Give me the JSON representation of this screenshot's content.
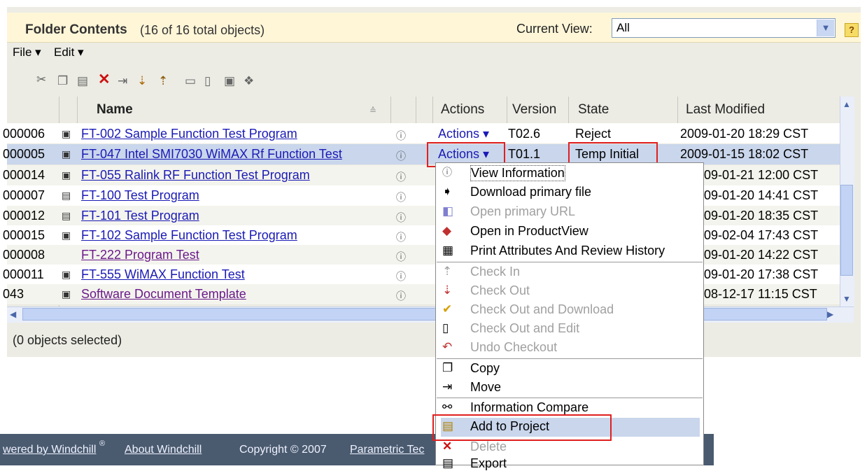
{
  "header": {
    "title": "Folder Contents",
    "count": "(16 of 16 total objects)",
    "view_label": "Current View:",
    "view_value": "All",
    "help": "?"
  },
  "menubar": {
    "file": "File ▾",
    "edit": "Edit ▾"
  },
  "toolbar": {
    "icons": [
      "cut-icon",
      "copy-icon",
      "paste-icon",
      "delete-icon",
      "move-icon",
      "checkout-icon",
      "checkin-icon",
      "new-folder-icon",
      "new-document-icon",
      "new-part-icon",
      "new-link-icon"
    ]
  },
  "columns": {
    "name": "Name",
    "actions": "Actions",
    "version": "Version",
    "state": "State",
    "last_modified": "Last Modified"
  },
  "rows": [
    {
      "number": "000006",
      "name": "FT-002 Sample Function Test Program",
      "actions": "Actions ▾",
      "version": "T02.6",
      "state": "Reject",
      "modified": "2009-01-20 18:29 CST"
    },
    {
      "number": "000005",
      "name": "FT-047 Intel SMI7030 WiMAX Rf Function Test",
      "actions": "Actions ▾",
      "version": "T01.1",
      "state": "Temp Initial",
      "modified": "2009-01-15 18:02 CST"
    },
    {
      "number": "000014",
      "name": "FT-055 Ralink RF Function Test Program",
      "modified": "09-01-21 12:00 CST"
    },
    {
      "number": "000007",
      "name": "FT-100 Test Program",
      "modified": "09-01-20 14:41 CST"
    },
    {
      "number": "000012",
      "name": "FT-101 Test Program",
      "modified": "09-01-20 18:35 CST"
    },
    {
      "number": "000015",
      "name": "FT-102 Sample Function Test Program",
      "modified": "09-02-04 17:43 CST"
    },
    {
      "number": "000008",
      "name": "FT-222 Program Test",
      "modified": "09-01-20 14:22 CST"
    },
    {
      "number": "000011",
      "name": "FT-555 WiMAX Function Test",
      "modified": "09-01-20 17:38 CST"
    },
    {
      "number": "043",
      "name": "Software Document Template",
      "modified": "08-12-17 11:15 CST"
    }
  ],
  "status": "(0 objects selected)",
  "context_menu": [
    {
      "label": "View Information",
      "icon": "info-icon",
      "enabled": true
    },
    {
      "label": "Download primary file",
      "icon": "download-icon",
      "enabled": true
    },
    {
      "label": "Open primary URL",
      "icon": "url-icon",
      "enabled": false
    },
    {
      "label": "Open in ProductView",
      "icon": "productview-icon",
      "enabled": true
    },
    {
      "label": "Print Attributes And Review History",
      "icon": "print-icon",
      "enabled": true
    },
    {
      "label": "Check In",
      "icon": "checkin-icon",
      "enabled": false
    },
    {
      "label": "Check Out",
      "icon": "checkout-icon",
      "enabled": false
    },
    {
      "label": "Check Out and Download",
      "icon": "checkout-download-icon",
      "enabled": false
    },
    {
      "label": "Check Out and Edit",
      "icon": "checkout-edit-icon",
      "enabled": false
    },
    {
      "label": "Undo Checkout",
      "icon": "undo-checkout-icon",
      "enabled": false
    },
    {
      "label": "Copy",
      "icon": "copy-icon",
      "enabled": true
    },
    {
      "label": "Move",
      "icon": "move-icon",
      "enabled": true
    },
    {
      "label": "Information Compare",
      "icon": "compare-icon",
      "enabled": true
    },
    {
      "label": "Add to Project",
      "icon": "add-project-icon",
      "enabled": true
    },
    {
      "label": "Delete",
      "icon": "delete-icon",
      "enabled": false
    },
    {
      "label": "Export",
      "icon": "export-icon",
      "enabled": true
    }
  ],
  "footer": {
    "powered": "wered by Windchill",
    "reg": "®",
    "about": "About Windchill",
    "copyright": "Copyright © 2007",
    "company": "Parametric Tec"
  }
}
